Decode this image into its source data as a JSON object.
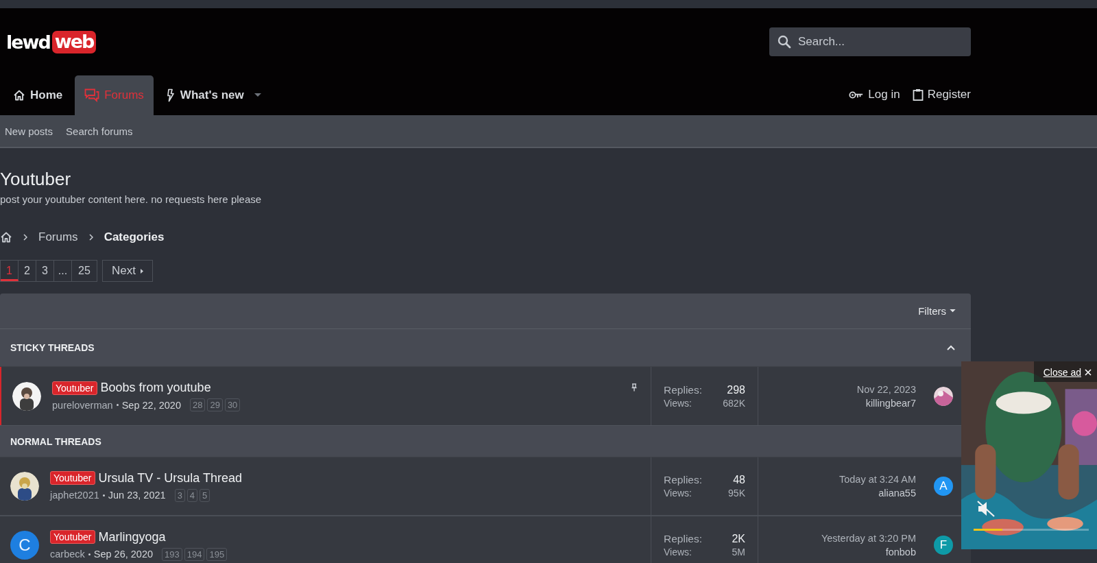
{
  "header": {
    "logo": {
      "part_1": "lewd",
      "part_2": "web"
    },
    "search": {
      "placeholder": "Search..."
    },
    "tabs": [
      {
        "label": "Home",
        "kind": "home",
        "selected": false,
        "dropdown": false
      },
      {
        "label": "Forums",
        "kind": "forums",
        "selected": true,
        "dropdown": false
      },
      {
        "label": "What's new",
        "kind": "whats_new",
        "selected": false,
        "dropdown": true
      }
    ],
    "account_links": [
      {
        "label": "Log in",
        "kind": "key"
      },
      {
        "label": "Register",
        "kind": "clipboard"
      }
    ]
  },
  "subnav": [
    "New posts",
    "Search forums"
  ],
  "page": {
    "title": "Youtuber",
    "description": "post your youtuber content here. no requests here please"
  },
  "breadcrumb": [
    {
      "label": "Forums",
      "current": false
    },
    {
      "label": "Categories",
      "current": true
    }
  ],
  "pagination": {
    "pages": [
      {
        "label": "1",
        "selected": true
      },
      {
        "label": "2",
        "selected": false
      },
      {
        "label": "3",
        "selected": false
      },
      {
        "label": "...",
        "selected": false
      },
      {
        "label": "25",
        "selected": false
      }
    ],
    "next": "Next"
  },
  "filters": "Filters",
  "sections": [
    {
      "title": "STICKY THREADS",
      "collapsible": true,
      "threads": [
        {
          "sticky": true,
          "avatar": {
            "kind": "picture"
          },
          "prefix": "Youtuber",
          "title": "Boobs from youtube",
          "author": "pureloverman",
          "date": "Sep 22, 2020",
          "pages": [
            "28",
            "29",
            "30"
          ],
          "replies_label": "Replies:",
          "replies": "298",
          "views_label": "Views:",
          "views": "682K",
          "last_date": "Nov 22, 2023",
          "last_user": "killingbear7",
          "last_avatar": {
            "kind": "picture"
          }
        }
      ]
    },
    {
      "title": "NORMAL THREADS",
      "collapsible": false,
      "threads": [
        {
          "sticky": false,
          "avatar": {
            "kind": "picture"
          },
          "prefix": "Youtuber",
          "title": "Ursula TV - Ursula Thread",
          "author": "japhet2021",
          "date": "Jun 23, 2021",
          "pages": [
            "3",
            "4",
            "5"
          ],
          "replies_label": "Replies:",
          "replies": "48",
          "views_label": "Views:",
          "views": "95K",
          "last_date": "Today at 3:24 AM",
          "last_user": "aliana55",
          "last_avatar": {
            "kind": "letter",
            "letter": "A",
            "color": "#2196f3"
          }
        },
        {
          "sticky": false,
          "avatar": {
            "kind": "letter",
            "letter": "C",
            "color": "#1e7fe0"
          },
          "prefix": "Youtuber",
          "title": "Marlingyoga",
          "author": "carbeck",
          "date": "Sep 26, 2020",
          "pages": [
            "193",
            "194",
            "195"
          ],
          "replies_label": "Replies:",
          "replies": "2K",
          "views_label": "Views:",
          "views": "5M",
          "last_date": "Yesterday at 3:20 PM",
          "last_user": "fonbob",
          "last_avatar": {
            "kind": "letter",
            "letter": "F",
            "color": "#0e9aa7"
          }
        }
      ]
    }
  ],
  "ad": {
    "kind": "picture",
    "close_label": "Close ad",
    "muted": true,
    "level": 0.25
  }
}
